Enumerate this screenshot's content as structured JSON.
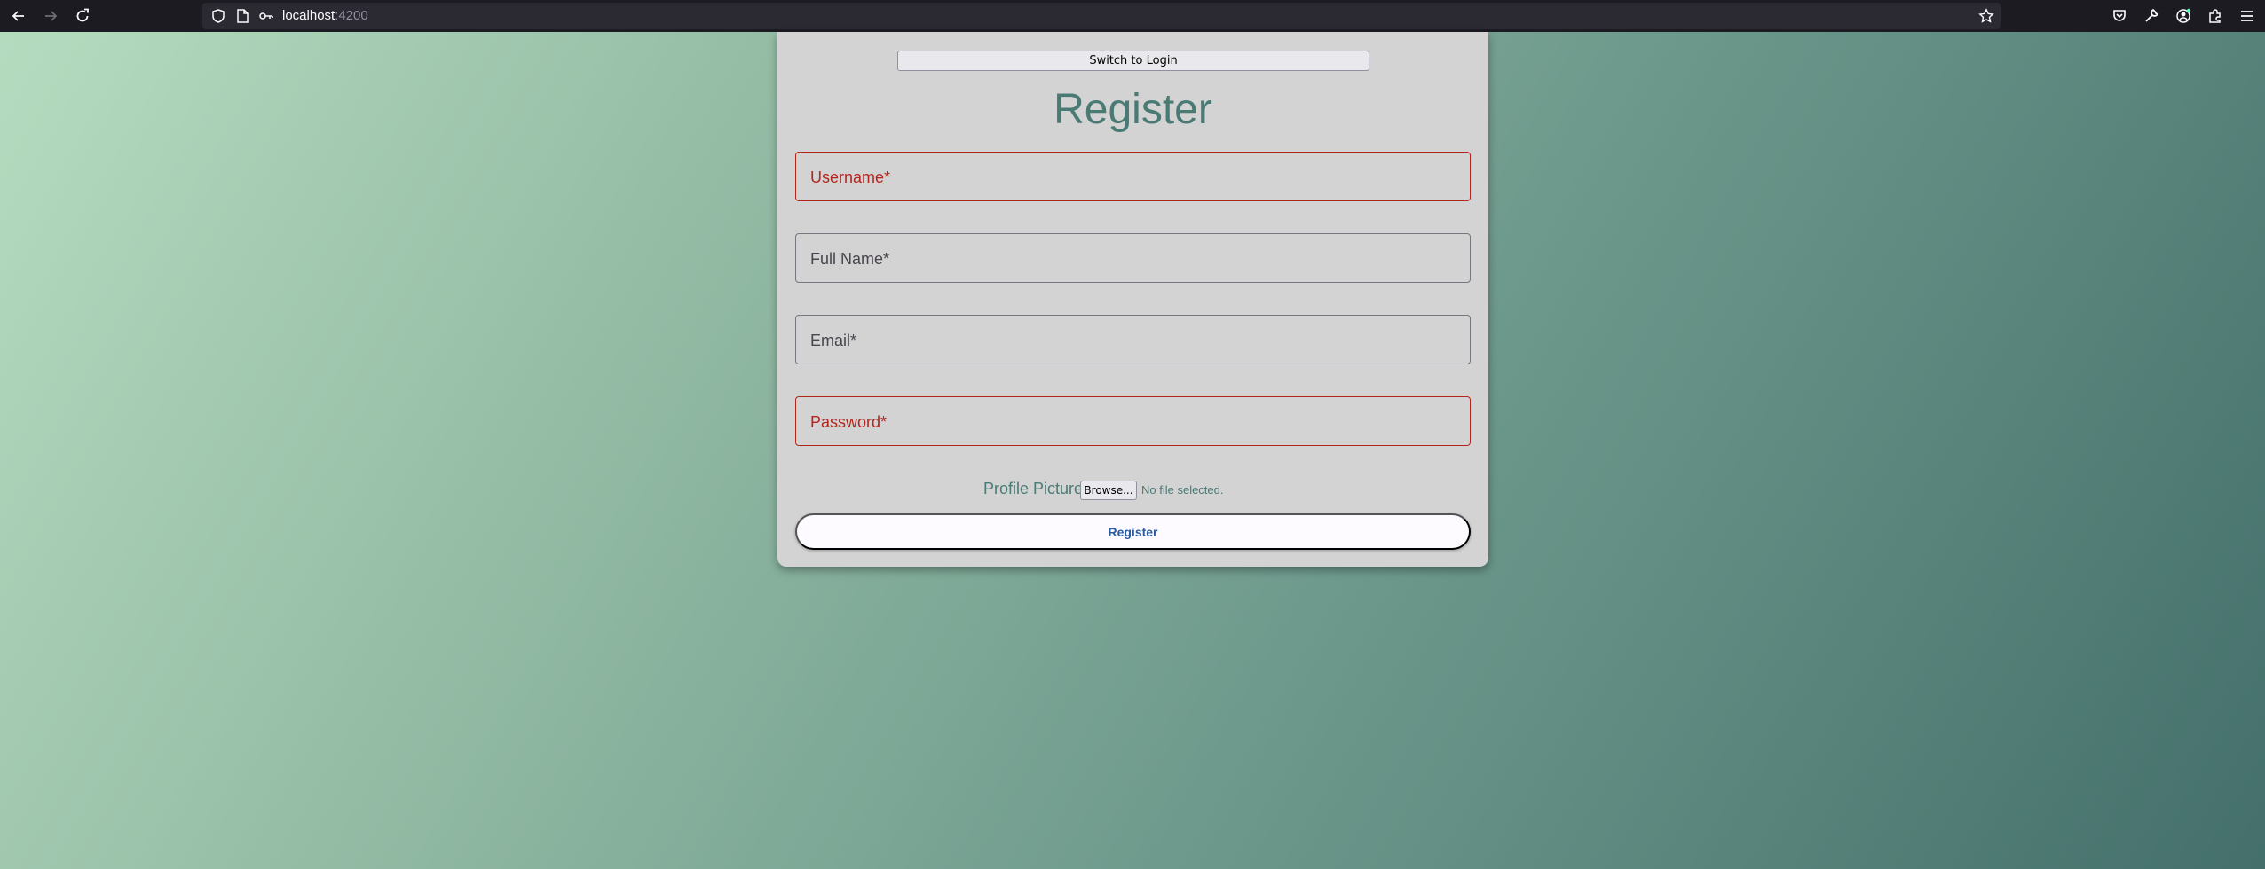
{
  "browser": {
    "url_host": "localhost",
    "url_port": ":4200",
    "icons": [
      "back-arrow-icon",
      "forward-arrow-icon",
      "reload-icon",
      "shield-icon",
      "page-icon",
      "key-icon",
      "star-icon",
      "pocket-icon",
      "wrench-icon",
      "account-icon",
      "extensions-icon",
      "menu-icon"
    ]
  },
  "form": {
    "switch_label": "Switch to Login",
    "title": "Register",
    "fields": [
      {
        "label": "Username*",
        "state": "error"
      },
      {
        "label": "Full Name*",
        "state": "normal"
      },
      {
        "label": "Email*",
        "state": "normal"
      },
      {
        "label": "Password*",
        "state": "error"
      }
    ],
    "profile_label": "Profile Picture",
    "browse_label": "Browse...",
    "file_status": "No file selected.",
    "submit_label": "Register"
  },
  "colors": {
    "accent": "#4a7a74",
    "error": "#b3261e",
    "card": "#d3d3d3",
    "submit_text": "#2a5aa0"
  }
}
